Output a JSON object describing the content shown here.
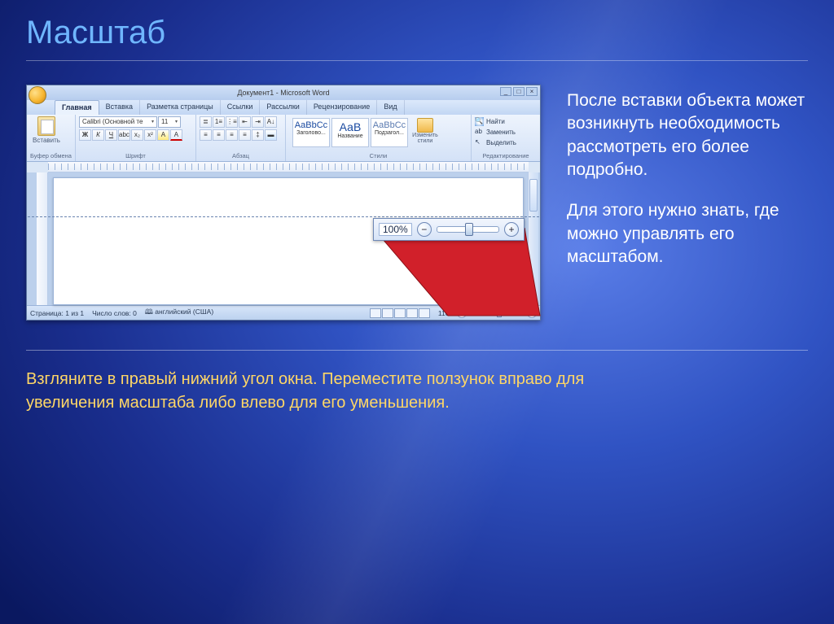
{
  "slide": {
    "title": "Масштаб",
    "paragraph1": "После вставки объекта может возникнуть необходимость рассмотреть его более подробно.",
    "paragraph2": "Для этого нужно знать, где можно управлять его масштабом.",
    "instruction": "Взгляните в правый нижний угол окна. Переместите ползунок вправо для увеличения масштаба либо влево для его уменьшения."
  },
  "word": {
    "title": "Документ1 - Microsoft Word",
    "tabs": [
      "Главная",
      "Вставка",
      "Разметка страницы",
      "Ссылки",
      "Рассылки",
      "Рецензирование",
      "Вид"
    ],
    "active_tab_index": 0,
    "groups": {
      "clipboard": "Буфер обмена",
      "font": "Шрифт",
      "paragraph": "Абзац",
      "styles": "Стили",
      "editing": "Редактирование"
    },
    "font": {
      "name": "Calibri (Основной те",
      "size": "11"
    },
    "style_boxes": [
      {
        "sample": "AaBbCc",
        "label": "Заголово..."
      },
      {
        "sample": "АаВ",
        "label": "Название"
      },
      {
        "sample": "AaBbCc",
        "label": "Подзагол..."
      }
    ],
    "change_styles": "Изменить стили",
    "editing_items": [
      "Найти",
      "Заменить",
      "Выделить"
    ],
    "paste": "Вставить",
    "status": {
      "page": "Страница: 1 из 1",
      "words": "Число слов: 0",
      "lang": "английский (США)",
      "zoom_small": "110%"
    }
  },
  "callout": {
    "zoom_pct": "100%"
  }
}
